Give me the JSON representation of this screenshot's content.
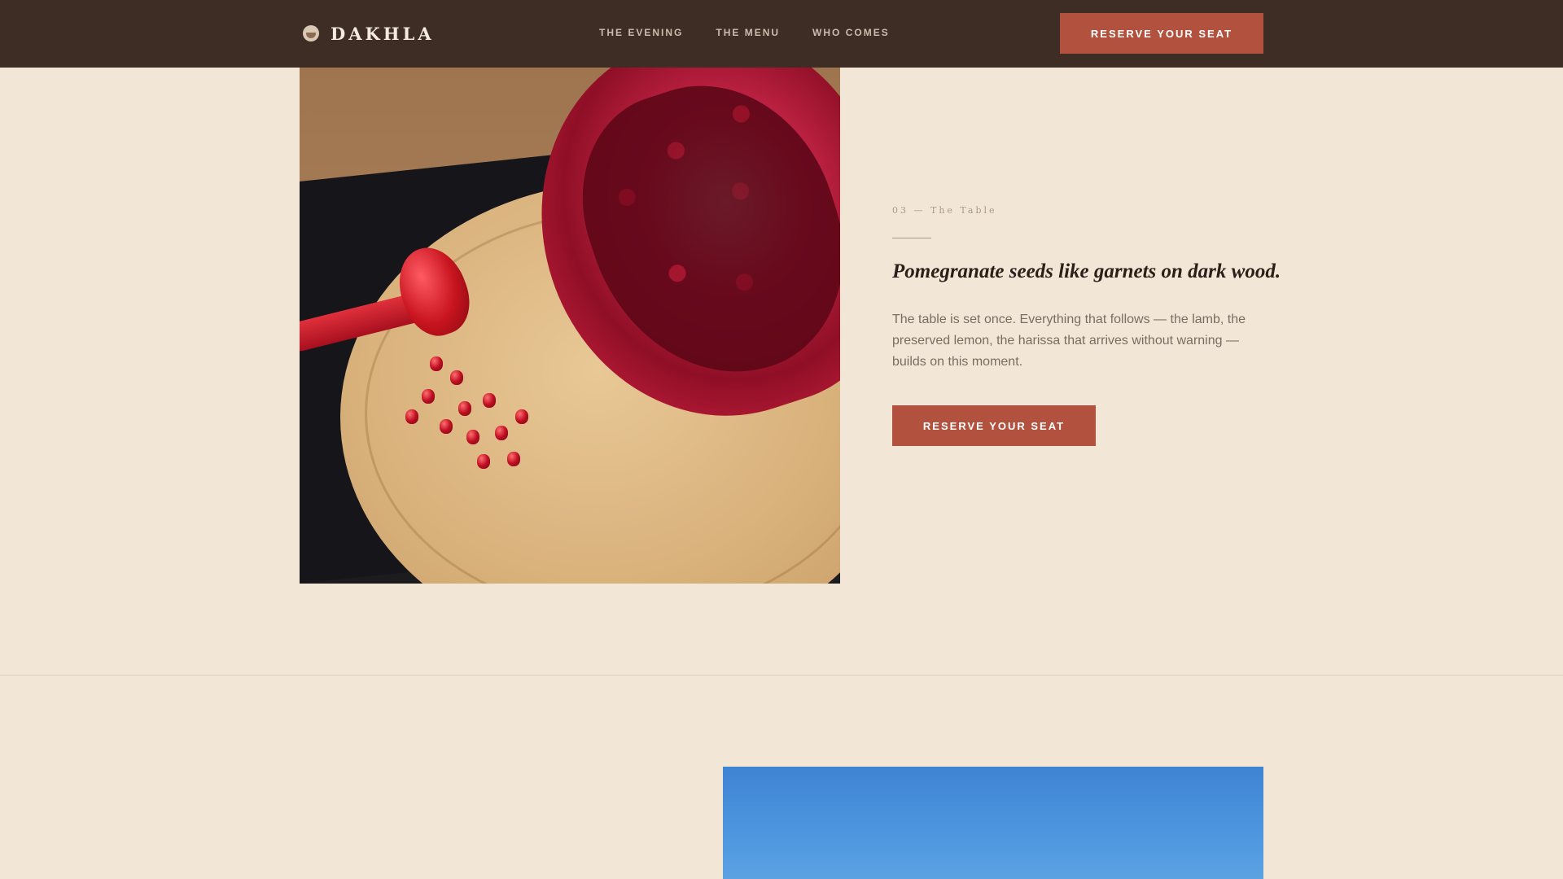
{
  "header": {
    "brand_name": "DAKHLA",
    "nav": [
      "THE EVENING",
      "THE MENU",
      "WHO COMES"
    ],
    "cta_label": "RESERVE YOUR SEAT"
  },
  "section": {
    "eyebrow": "03 — The Table",
    "headline": "Pomegranate seeds like garnets on dark wood.",
    "body": "The table is set once. Everything that follows — the lamb, the preserved lemon, the harissa that arrives without warning — builds on this moment.",
    "cta_label": "RESERVE YOUR SEAT"
  },
  "colors": {
    "header_bg": "#3d2d25",
    "page_bg": "#f2e6d6",
    "accent": "#b2513d"
  }
}
